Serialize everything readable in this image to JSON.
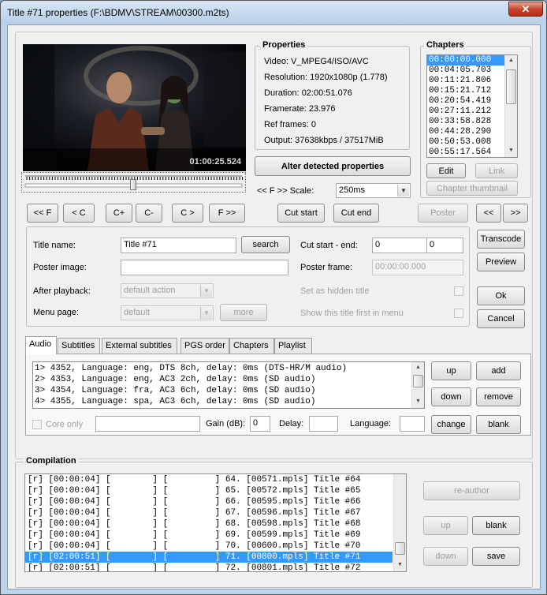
{
  "window": {
    "title": "Title #71 properties (F:\\BDMV\\STREAM\\00300.m2ts)",
    "close_glyph": "✕"
  },
  "video": {
    "timestamp": "01:00:25.524"
  },
  "nav": {
    "prev_f": "<< F",
    "prev_c": "< C",
    "c_plus": "C+",
    "c_minus": "C-",
    "next_c": "C >",
    "next_f": "F >>",
    "cut_start": "Cut start",
    "cut_end": "Cut end",
    "poster": "Poster",
    "prev": "<<",
    "next": ">>"
  },
  "properties": {
    "title": "Properties",
    "lines": [
      "Video: V_MPEG4/ISO/AVC",
      "Resolution: 1920x1080p (1.778)",
      "Duration: 02:00:51.076",
      "Framerate: 23.976",
      "Ref frames: 0",
      "Output: 37638kbps / 37517MiB"
    ],
    "alter_button": "Alter detected properties",
    "scale_label": "<< F >> Scale:",
    "scale_value": "250ms"
  },
  "chapters": {
    "title": "Chapters",
    "items": [
      "00:00:00.000",
      "00:04:05.703",
      "00:11:21.806",
      "00:15:21.712",
      "00:20:54.419",
      "00:27:11.212",
      "00:33:58.828",
      "00:44:28.290",
      "00:50:53.008",
      "00:55:17.564"
    ],
    "edit": "Edit",
    "link": "Link",
    "thumb": "Chapter thumbnail"
  },
  "title_form": {
    "title_name_label": "Title name:",
    "title_name_value": "Title #71",
    "search": "search",
    "poster_image_label": "Poster image:",
    "poster_image_value": "",
    "after_playback_label": "After playback:",
    "after_playback_value": "default action",
    "menu_page_label": "Menu page:",
    "menu_page_value": "default",
    "more": "more",
    "cut_label": "Cut start - end:",
    "cut_start_value": "0",
    "cut_dash": "-",
    "cut_end_value": "0",
    "poster_frame_label": "Poster frame:",
    "poster_frame_value": "00:00:00.000",
    "hidden_label": "Set as hidden title",
    "first_label": "Show this title first in menu"
  },
  "side_buttons": {
    "transcode": "Transcode",
    "preview": "Preview",
    "ok": "Ok",
    "cancel": "Cancel"
  },
  "tabs": [
    "Audio",
    "Subtitles",
    "External subtitles",
    "PGS order",
    "Chapters",
    "Playlist"
  ],
  "audio": {
    "tracks": [
      "1> 4352, Language: eng, DTS 8ch, delay: 0ms (DTS-HR/M audio)",
      "2> 4353, Language: eng, AC3 2ch, delay: 0ms (SD audio)",
      "3> 4354, Language: fra, AC3 6ch, delay: 0ms (SD audio)",
      "4> 4355, Language: spa, AC3 6ch, delay: 0ms (SD audio)"
    ],
    "up": "up",
    "add": "add",
    "down": "down",
    "remove": "remove",
    "change": "change",
    "blank": "blank",
    "core_only": "Core only",
    "core_value": "",
    "gain_label": "Gain (dB):",
    "gain_value": "0",
    "delay_label": "Delay:",
    "delay_value": "",
    "language_label": "Language:",
    "language_value": ""
  },
  "compilation": {
    "title": "Compilation",
    "rows": [
      "[r] [00:00:04] [        ] [         ] 64. [00571.mpls] Title #64",
      "[r] [00:00:04] [        ] [         ] 65. [00572.mpls] Title #65",
      "[r] [00:00:04] [        ] [         ] 66. [00595.mpls] Title #66",
      "[r] [00:00:04] [        ] [         ] 67. [00596.mpls] Title #67",
      "[r] [00:00:04] [        ] [         ] 68. [00598.mpls] Title #68",
      "[r] [00:00:04] [        ] [         ] 69. [00599.mpls] Title #69",
      "[r] [00:00:04] [        ] [         ] 70. [00600.mpls] Title #70",
      "[r] [02:00:51] [        ] [         ] 71. [00800.mpls] Title #71",
      "[r] [02:00:51] [        ] [         ] 72. [00801.mpls] Title #72"
    ],
    "selected_index": 7,
    "reauthor": "re-author",
    "up": "up",
    "blank": "blank",
    "down": "down",
    "save": "save"
  },
  "colors": {
    "selection": "#3399ff",
    "accent_border": "#3399ff"
  }
}
